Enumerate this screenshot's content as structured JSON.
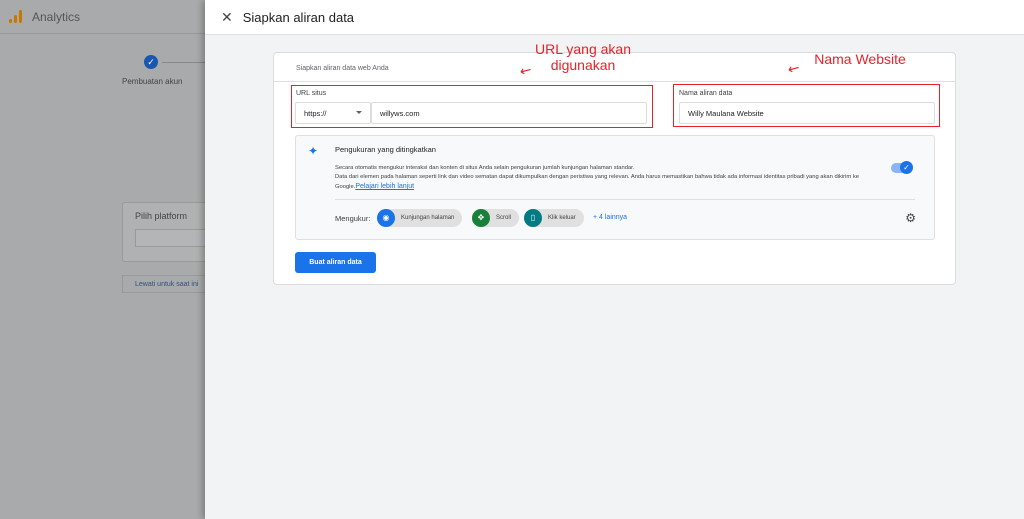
{
  "background": {
    "app_title": "Analytics",
    "step_label": "Pembuatan akun",
    "platform_label": "Pilih platform",
    "skip_button": "Lewati untuk saat ini"
  },
  "panel": {
    "title": "Siapkan aliran data",
    "card_subtitle": "Siapkan aliran data web Anda",
    "url": {
      "label": "URL situs",
      "protocol": "https://",
      "value": "willyws.com"
    },
    "stream_name": {
      "label": "Nama aliran data",
      "value": "Willy Maulana Website"
    },
    "enhanced": {
      "title": "Pengukuran yang ditingkatkan",
      "desc1": "Secara otomatis mengukur interaksi dan konten di situs Anda selain pengukuran jumlah kunjungan halaman standar.",
      "desc2": "Data dari elemen pada halaman seperti link dan video sematan dapat dikumpulkan dengan peristiwa yang relevan. Anda harus memastikan bahwa tidak ada informasi identitas pribadi yang akan dikirim ke Google.",
      "learn_more": "Pelajari lebih lanjut",
      "enabled": true,
      "measure_label": "Mengukur:",
      "chips": [
        {
          "label": "Kunjungan halaman",
          "icon": "eye-icon",
          "color": "#1a73e8"
        },
        {
          "label": "Scroll",
          "icon": "scroll-icon",
          "color": "#188038"
        },
        {
          "label": "Klik keluar",
          "icon": "mouse-icon",
          "color": "#007b83"
        }
      ],
      "more": "+ 4 lainnya"
    },
    "create_button": "Buat aliran data"
  },
  "annotations": {
    "url_note": "URL yang akan digunakan",
    "name_note": "Nama Website",
    "color": "#e8222a"
  }
}
